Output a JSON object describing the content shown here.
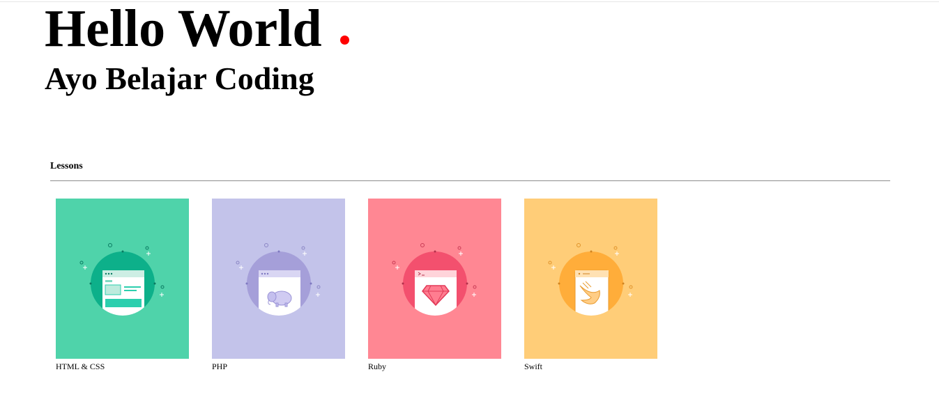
{
  "hero": {
    "title": "Hello World",
    "subtitle": "Ayo Belajar Coding",
    "dot_color": "#ff0000"
  },
  "lessons": {
    "heading": "Lessons",
    "cards": [
      {
        "label": "HTML & CSS",
        "icon": "html-css-icon",
        "bg": "#4fd3aa",
        "circle": "#0db08a",
        "accent": "#2ccfae"
      },
      {
        "label": "PHP",
        "icon": "php-elephant-icon",
        "bg": "#c3c3ea",
        "circle": "#a59fd9",
        "accent": "#b8b0ec"
      },
      {
        "label": "Ruby",
        "icon": "ruby-gem-icon",
        "bg": "#ff8793",
        "circle": "#f3506e",
        "accent": "#ff6b80"
      },
      {
        "label": "Swift",
        "icon": "swift-bird-icon",
        "bg": "#ffcd78",
        "circle": "#ffad3a",
        "accent": "#ffb44b"
      }
    ]
  }
}
